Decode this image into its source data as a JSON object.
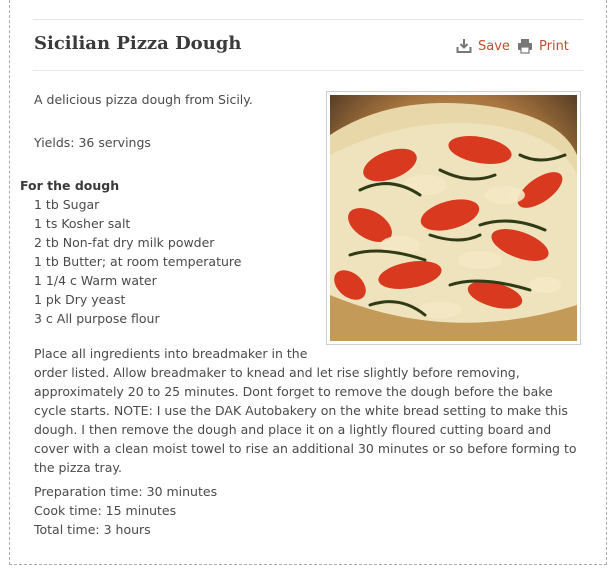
{
  "recipe": {
    "title": "Sicilian Pizza Dough",
    "actions": {
      "save_label": "Save",
      "print_label": "Print"
    },
    "description": "A delicious pizza dough from Sicily.",
    "yields": "Yields: 36 servings",
    "section_heading": "For the dough",
    "ingredients": [
      "1 tb Sugar",
      "1 ts Kosher salt",
      "2 tb Non-fat dry milk powder",
      "1 tb Butter; at room temperature",
      "1 1/4 c Warm water",
      "1 pk Dry yeast",
      "3 c All purpose flour"
    ],
    "instructions_first": "Place all ingredients into breadmaker in the",
    "instructions_rest": "order listed. Allow breadmaker to knead and let rise slightly before removing, approximately 20 to 25 minutes. Dont forget to remove the dough before the bake cycle starts. NOTE: I use the DAK Autobakery on the white bread setting to make this dough. I then remove the dough and place it on a lightly floured cutting board and cover with a clean moist towel to rise an additional 30 minutes or so before forming to the pizza tray.",
    "times": {
      "prep": "Preparation time: 30 minutes",
      "cook": "Cook time: 15 minutes",
      "total": "Total time: 3 hours"
    }
  },
  "icons": {
    "save": "download-tray-icon",
    "print": "printer-icon"
  },
  "colors": {
    "accent": "#c0502c",
    "title": "#3a3a3a",
    "body_text": "#4a4a4a",
    "border": "#aaaaaa"
  }
}
